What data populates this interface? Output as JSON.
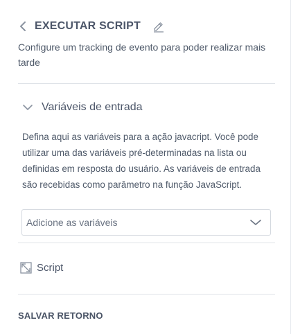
{
  "header": {
    "back_icon": "chevron-left-icon",
    "title": "EXECUTAR SCRIPT",
    "edit_icon": "pencil-icon"
  },
  "subtitle": "Configure um tracking de evento para poder realizar mais tarde",
  "input_section": {
    "toggle_icon": "chevron-down-icon",
    "title": "Variáveis de entrada",
    "description": "Defina aqui as variáveis para a ação javacript. Você pode utilizar uma das variáveis pré-determinadas na lista ou definidas em resposta do usuário. As variáveis de entrada são recebidas como parâmetro na função JavaScript.",
    "select": {
      "placeholder": "Adicione as variáveis",
      "caret_icon": "chevron-down-icon"
    }
  },
  "script": {
    "icon": "expand-diagonal-icon",
    "label": "Script"
  },
  "save_return": {
    "label": "SALVAR RETORNO"
  },
  "colors": {
    "text": "#4c5669",
    "muted_text": "#6a7382",
    "divider": "#dfe3e8",
    "border": "#d4d9df",
    "icon": "#8a93a0"
  }
}
